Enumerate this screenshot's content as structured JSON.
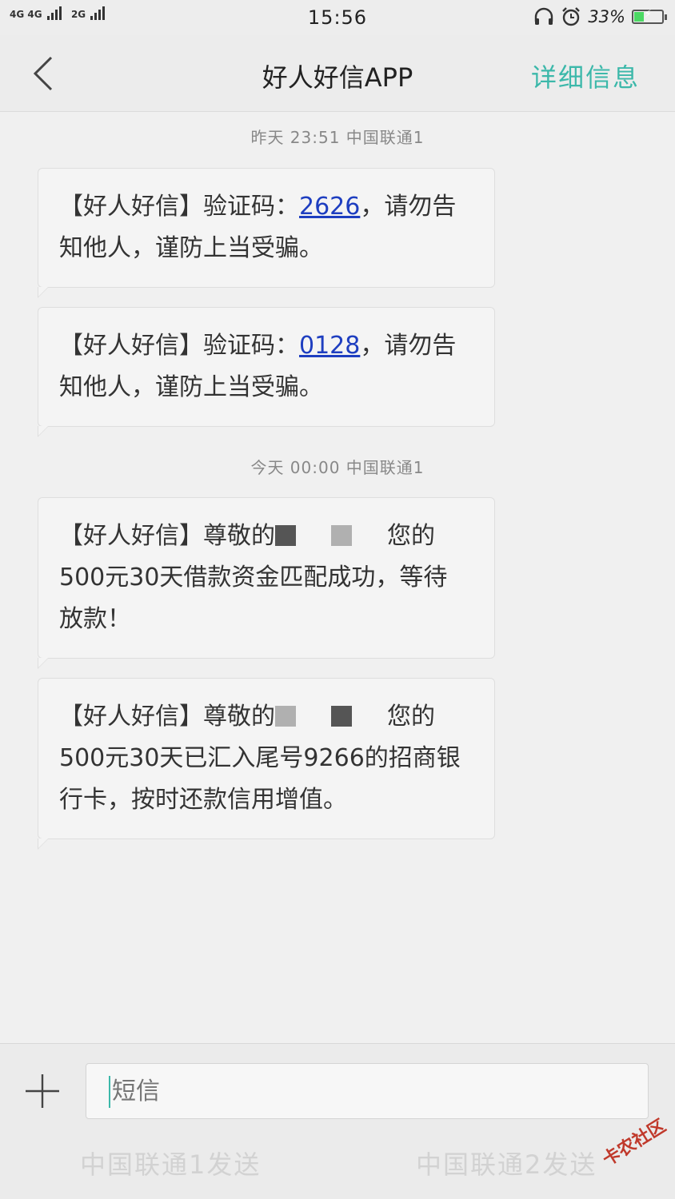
{
  "status_bar": {
    "network1": "4G 4G",
    "network2": "2G",
    "time": "15:56",
    "battery_percent": "33%",
    "battery_level": 0.33
  },
  "header": {
    "title": "好人好信APP",
    "detail_link": "详细信息"
  },
  "thread": {
    "stamp1": "昨天  23:51  中国联通1",
    "msg1": {
      "prefix": "【好人好信】验证码：",
      "code": "2626",
      "suffix": "，请勿告知他人，谨防上当受骗。"
    },
    "msg2": {
      "prefix": "【好人好信】验证码：",
      "code": "0128",
      "suffix": "，请勿告知他人，谨防上当受骗。"
    },
    "stamp2": "今天  00:00  中国联通1",
    "msg3": {
      "prefix": "【好人好信】尊敬的",
      "suffix": "您的500元30天借款资金匹配成功，等待放款！"
    },
    "msg4": {
      "prefix": "【好人好信】尊敬的",
      "suffix": "您的500元30天已汇入尾号9266的招商银行卡，按时还款信用增值。"
    }
  },
  "composer": {
    "placeholder": "短信",
    "send1": "中国联通1发送",
    "send2": "中国联通2发送"
  },
  "watermark": "卡农社区",
  "colors": {
    "accent": "#3cb8aa",
    "code_link": "#1e3ec0"
  }
}
